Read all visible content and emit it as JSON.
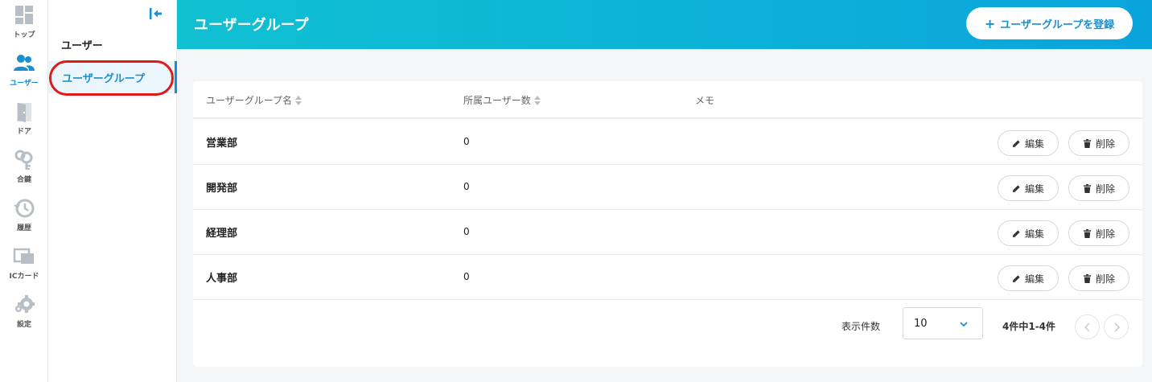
{
  "rail": {
    "items": [
      {
        "label": "トップ",
        "icon": "dashboard-icon"
      },
      {
        "label": "ユーザー",
        "icon": "users-icon"
      },
      {
        "label": "ドア",
        "icon": "door-icon"
      },
      {
        "label": "合鍵",
        "icon": "key-icon"
      },
      {
        "label": "履歴",
        "icon": "history-icon"
      },
      {
        "label": "ICカード",
        "icon": "ic-card-icon"
      },
      {
        "label": "設定",
        "icon": "gear-icon"
      }
    ]
  },
  "subnav": {
    "heading": "ユーザー",
    "active_item": "ユーザーグループ"
  },
  "header": {
    "title": "ユーザーグループ",
    "add_button_plus": "+",
    "add_button_label": "ユーザーグループを登録"
  },
  "table": {
    "columns": {
      "name": "ユーザーグループ名",
      "count": "所属ユーザー数",
      "memo": "メモ"
    },
    "rows": [
      {
        "name": "営業部",
        "count": "0",
        "memo": ""
      },
      {
        "name": "開発部",
        "count": "0",
        "memo": ""
      },
      {
        "name": "経理部",
        "count": "0",
        "memo": ""
      },
      {
        "name": "人事部",
        "count": "0",
        "memo": ""
      }
    ],
    "edit_label": "編集",
    "delete_label": "削除"
  },
  "pagination": {
    "per_page_label": "表示件数",
    "per_page_value": "10",
    "range_text": "4件中1-4件"
  },
  "colors": {
    "accent": "#1a8fd0",
    "header_gradient_start": "#10c1d2",
    "header_gradient_end": "#0aa4dc",
    "highlight": "#e01919"
  }
}
